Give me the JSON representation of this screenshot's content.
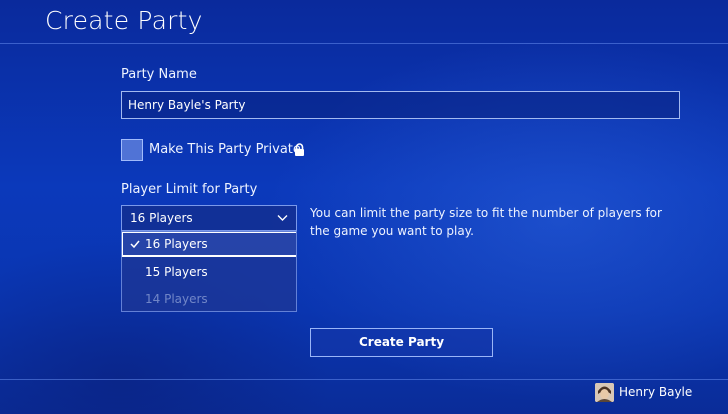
{
  "header": {
    "title": "Create Party"
  },
  "form": {
    "party_name_label": "Party Name",
    "party_name_value": "Henry Bayle's Party",
    "private_checkbox_label": "Make This Party Private",
    "private_checked": false,
    "player_limit_label": "Player Limit for Party",
    "player_limit_selected": "16 Players",
    "player_limit_options": [
      {
        "label": "16 Players",
        "selected": true
      },
      {
        "label": "15 Players",
        "selected": false
      },
      {
        "label": "14 Players",
        "selected": false
      }
    ],
    "player_limit_help": "You can limit the party size to fit the number of players for the game you want to play.",
    "create_button_label": "Create Party"
  },
  "icons": {
    "lock": "lock-icon",
    "chevron": "chevron-down-icon",
    "check": "check-icon"
  },
  "user": {
    "name": "Henry Bayle"
  },
  "colors": {
    "background": "#0b39bb",
    "text": "#ffffff",
    "checkbox_fill": "#5073d6"
  }
}
